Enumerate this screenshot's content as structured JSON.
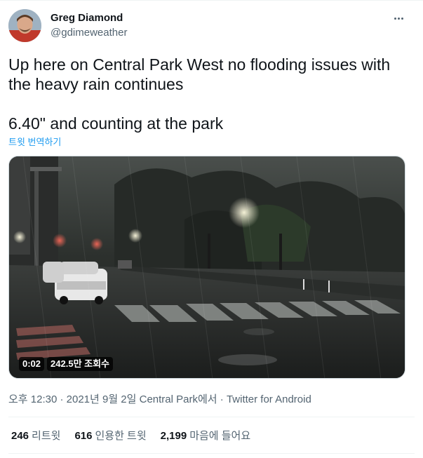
{
  "author": {
    "name": "Greg Diamond",
    "handle": "@gdimeweather"
  },
  "tweet": {
    "text": "Up here on Central Park West no flooding issues with the heavy rain continues\n\n6.40\" and counting at the park",
    "translate_label": "트윗 번역하기"
  },
  "video": {
    "duration": "0:02",
    "views": "242.5만 조회수"
  },
  "meta": {
    "time": "오후 12:30",
    "separator1": " · ",
    "date": "2021년 9월 2일",
    "location": " Central Park에서",
    "separator2": " · ",
    "source": "Twitter for Android"
  },
  "stats": {
    "retweets_count": "246",
    "retweets_label": "리트윗",
    "quotes_count": "616",
    "quotes_label": "인용한 트윗",
    "likes_count": "2,199",
    "likes_label": "마음에 들어요"
  },
  "colors": {
    "link": "#1d9bf0",
    "secondary_text": "#536471",
    "primary_text": "#0f1419"
  },
  "icons": {
    "more": "more-horizontal-icon"
  }
}
